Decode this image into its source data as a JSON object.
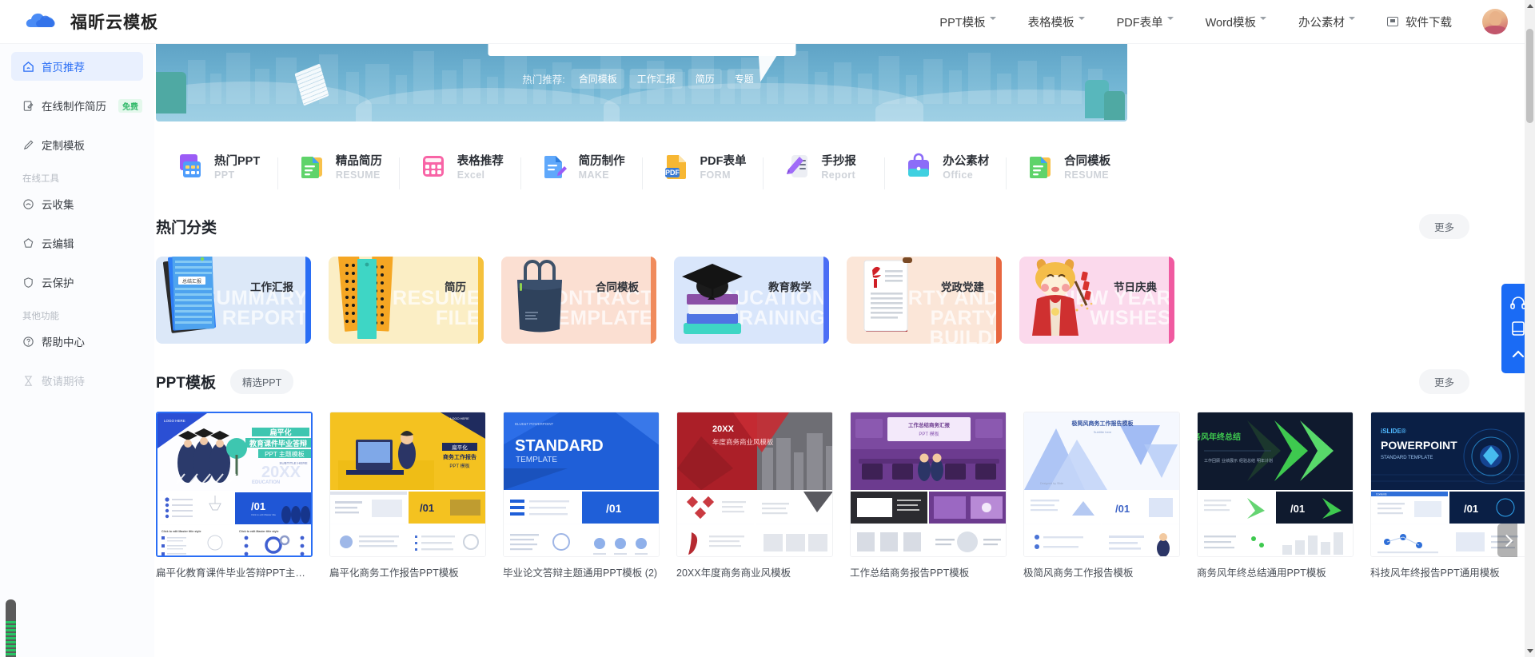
{
  "header": {
    "brand_title": "福昕云模板",
    "nav_items": [
      {
        "label": "PPT模板",
        "has_caret": true,
        "icon": null
      },
      {
        "label": "表格模板",
        "has_caret": true,
        "icon": null
      },
      {
        "label": "PDF表单",
        "has_caret": true,
        "icon": null
      },
      {
        "label": "Word模板",
        "has_caret": true,
        "icon": null
      },
      {
        "label": "办公素材",
        "has_caret": true,
        "icon": null
      },
      {
        "label": "软件下载",
        "has_caret": false,
        "icon": "download-icon"
      }
    ]
  },
  "sidebar": {
    "items": [
      {
        "label": "首页推荐",
        "icon": "home-icon",
        "active": true,
        "badge": null,
        "muted": false
      },
      {
        "label": "在线制作简历",
        "icon": "edit-doc-icon",
        "active": false,
        "badge": "免费",
        "muted": false
      },
      {
        "label": "定制模板",
        "icon": "pen-icon",
        "active": false,
        "badge": null,
        "muted": false
      }
    ],
    "group1_title": "在线工具",
    "group1_items": [
      {
        "label": "云收集",
        "icon": "cloud-collect-icon",
        "muted": false
      },
      {
        "label": "云编辑",
        "icon": "cloud-edit-icon",
        "muted": false
      },
      {
        "label": "云保护",
        "icon": "shield-icon",
        "muted": false
      }
    ],
    "group2_title": "其他功能",
    "group2_items": [
      {
        "label": "帮助中心",
        "icon": "help-icon",
        "muted": false
      },
      {
        "label": "敬请期待",
        "icon": "hourglass-icon",
        "muted": true
      }
    ]
  },
  "banner": {
    "hot_label": "热门推荐:",
    "hot_tags": [
      "合同模板",
      "工作汇报",
      "简历",
      "专题"
    ]
  },
  "quick_links": [
    {
      "title": "热门PPT",
      "sub": "PPT",
      "icon": "ppt-grid-icon",
      "c1": "#9b5cf6",
      "c2": "#4f9dfb"
    },
    {
      "title": "精品简历",
      "sub": "RESUME",
      "icon": "resume-doc-icon",
      "c1": "#5fd36a",
      "c2": "#f8c14b"
    },
    {
      "title": "表格推荐",
      "sub": "Excel",
      "icon": "table-icon",
      "c1": "#f864a6",
      "c2": "#9b5cf6"
    },
    {
      "title": "简历制作",
      "sub": "MAKE",
      "icon": "doc-pen-icon",
      "c1": "#5fa8fb",
      "c2": "#9b5cf6"
    },
    {
      "title": "PDF表单",
      "sub": "FORM",
      "icon": "pdf-icon",
      "c1": "#f7b733",
      "c2": "#3a7bd5"
    },
    {
      "title": "手抄报",
      "sub": "Report",
      "icon": "handwrite-icon",
      "c1": "#a06cf8",
      "c2": "#d9d9e4"
    },
    {
      "title": "办公素材",
      "sub": "Office",
      "icon": "briefcase-icon",
      "c1": "#8c6cf8",
      "c2": "#3fd0e0"
    },
    {
      "title": "合同模板",
      "sub": "RESUME",
      "icon": "contract-icon",
      "c1": "#5fd36a",
      "c2": "#f8c14b"
    }
  ],
  "categories_section": {
    "title": "热门分类",
    "more_label": "更多",
    "cards": [
      {
        "label": "工作汇报",
        "en": "SUMMARY\nREPORT",
        "bg": "#dce8f8",
        "edge": "#2a6ef5",
        "art": "report-stack-art"
      },
      {
        "label": "简历",
        "en": "RESUME\nFILE",
        "bg": "#fbeec5",
        "edge": "#f5c13c",
        "art": "resume-cards-art"
      },
      {
        "label": "合同模板",
        "en": "CONTRACT\nTEMPLATE",
        "bg": "#fbdfd2",
        "edge": "#f08b5c",
        "art": "tote-bag-art"
      },
      {
        "label": "教育教学",
        "en": "EDUCATION\nTRAINING",
        "bg": "#d9e6fb",
        "edge": "#4b6ef5",
        "art": "graduation-art"
      },
      {
        "label": "党政党建",
        "en": "PARTY AND\nPARTY BUILDI",
        "bg": "#fbe6d8",
        "edge": "#e8663f",
        "art": "party-doc-art"
      },
      {
        "label": "节日庆典",
        "en": "NEW YEAR\nWISHES",
        "bg": "#fbd9ec",
        "edge": "#f05aa0",
        "art": "ox-mascot-art"
      }
    ]
  },
  "ppt_section": {
    "title": "PPT模板",
    "chip_label": "精选PPT",
    "more_label": "更多",
    "cards": [
      {
        "name": "扁平化教育课件毕业答辩PPT主题模板",
        "selected": true,
        "hero": "#2b4fd4",
        "accent": "#3ec6b0"
      },
      {
        "name": "扁平化商务工作报告PPT模板",
        "selected": false,
        "hero": "#f4c220",
        "accent": "#1f2b5e"
      },
      {
        "name": "毕业论文答辩主题通用PPT模板 (2)",
        "selected": false,
        "hero": "#1f5fd8",
        "accent": "#4f8df7"
      },
      {
        "name": "20XX年度商务商业风模板",
        "selected": false,
        "hero": "#ab1f28",
        "accent": "#7d7d85"
      },
      {
        "name": "工作总结商务报告PPT模板",
        "selected": false,
        "hero": "#6c3b8f",
        "accent": "#b57fd6"
      },
      {
        "name": "极简风商务工作报告模板",
        "selected": false,
        "hero": "#eef2fb",
        "accent": "#5b8af5"
      },
      {
        "name": "商务风年终总结通用PPT模板",
        "selected": false,
        "hero": "#0f1a2e",
        "accent": "#4fd14f"
      },
      {
        "name": "科技风年终报告PPT通用模板",
        "selected": false,
        "hero": "#0a1f45",
        "accent": "#2fa8f5"
      }
    ]
  },
  "float_toolbar": {
    "buttons": [
      {
        "icon": "headset-icon",
        "name": "customer-service"
      },
      {
        "icon": "mobile-qr-icon",
        "name": "mobile-app"
      },
      {
        "icon": "chevron-up-icon",
        "name": "back-to-top"
      }
    ]
  },
  "colors": {
    "accent": "#2a6ef5",
    "banner_blue": "#6fb3d2",
    "float_blue": "#1a6bf5"
  }
}
